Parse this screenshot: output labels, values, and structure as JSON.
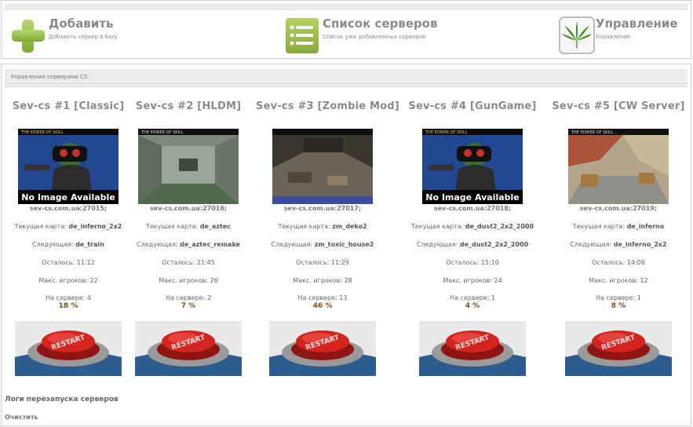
{
  "nav": [
    {
      "title": "Добавить",
      "subtitle": "Добавить сервер в базу",
      "icon": "plus-icon"
    },
    {
      "title": "Список серверов",
      "subtitle": "Список уже добавленных серверов",
      "icon": "list-icon"
    },
    {
      "title": "Управление",
      "subtitle": "Управление",
      "icon": "cannabis-leaf-icon"
    }
  ],
  "breadcrumb": "Управление серверами CS :",
  "labels": {
    "map": "Текущая карта:",
    "next": "Следующая:",
    "left": "Осталось:",
    "max": "Макс. игроков:",
    "online": "На сервере:"
  },
  "servers": [
    {
      "title": "Sev-cs #1 [Classic]",
      "addr": "sev-cs.com.ua:27015;",
      "map": "de_inferno_2x2",
      "next": "de_train",
      "left": "11:12",
      "max": "22",
      "online": "4",
      "percent": "18",
      "pct_text": "18 %",
      "image": "no-image"
    },
    {
      "title": "Sev-cs #2 [HLDM]",
      "addr": "sev-cs.com.ua:27016;",
      "map": "de_aztec",
      "next": "de_aztec_remake",
      "left": "21:45",
      "max": "26",
      "online": "2",
      "percent": "7",
      "pct_text": "7 %",
      "image": "aztec"
    },
    {
      "title": "Sev-cs #3 [Zombie Mod]",
      "addr": "sev-cs.com.ua:27017;",
      "map": "zm_deko2",
      "next": "zm_toxic_house2",
      "left": "11:29",
      "max": "28",
      "online": "13",
      "percent": "46",
      "pct_text": "46 %",
      "image": "deko"
    },
    {
      "title": "Sev-cs #4 [GunGame]",
      "addr": "sev-cs.com.ua:27018;",
      "map": "de_dust2_2x2_2000",
      "next": "de_dust2_2x2_2000",
      "left": "15:10",
      "max": "24",
      "online": "1",
      "percent": "4",
      "pct_text": "4 %",
      "image": "no-image"
    },
    {
      "title": "Sev-cs #5 [CW Server]",
      "addr": "sev-cs.com.ua:27019;",
      "map": "de_inferno",
      "next": "de_inferno_2x2",
      "left": "14:06",
      "max": "12",
      "online": "1",
      "percent": "8",
      "pct_text": "8 %",
      "image": "inferno"
    }
  ],
  "no_image_text": "No Image Available",
  "thumb_caption": "THE POWER OF SKILL",
  "restart_label": "RESTART",
  "logs_title": "Логи перезапуска серверов",
  "clear_label": "Очистить",
  "colors": {
    "accent_green": "#8cb83a",
    "percent_brown": "#8b4a1a",
    "title_gray": "#8a8a8a"
  }
}
